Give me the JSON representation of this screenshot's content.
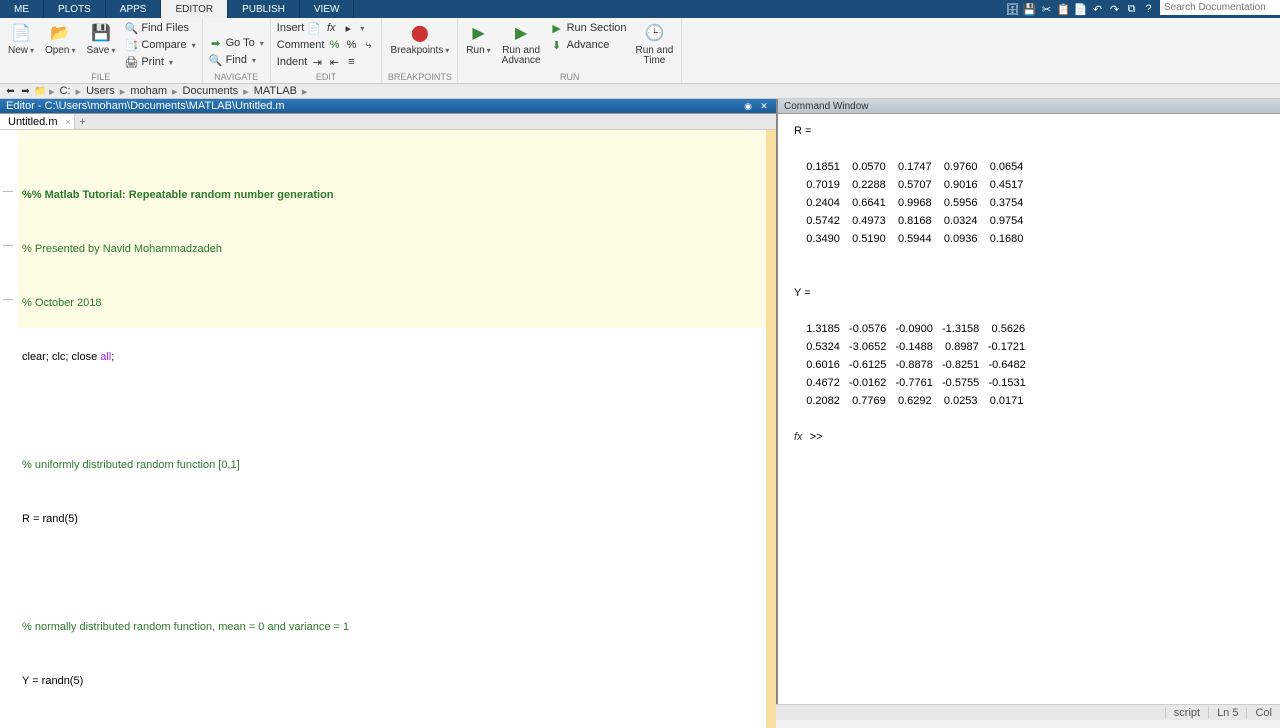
{
  "tabs": {
    "home": "ME",
    "plots": "PLOTS",
    "apps": "APPS",
    "editor": "EDITOR",
    "publish": "PUBLISH",
    "view": "VIEW"
  },
  "search_placeholder": "Search Documentation",
  "ribbon": {
    "file": {
      "new": "New",
      "open": "Open",
      "save": "Save",
      "findfiles": "Find Files",
      "compare": "Compare",
      "print": "Print",
      "label": "FILE"
    },
    "nav": {
      "goto": "Go To",
      "find": "Find",
      "label": "NAVIGATE"
    },
    "edit": {
      "insert": "Insert",
      "comment": "Comment",
      "indent": "Indent",
      "fx": "fx",
      "label": "EDIT"
    },
    "bp": {
      "breakpoints": "Breakpoints",
      "label": "BREAKPOINTS"
    },
    "run": {
      "run": "Run",
      "runadv": "Run and\nAdvance",
      "runsec": "Run Section",
      "advance": "Advance",
      "runtime": "Run and\nTime",
      "label": "RUN"
    }
  },
  "path": [
    "C:",
    "Users",
    "moham",
    "Documents",
    "MATLAB"
  ],
  "editor_title": "Editor - C:\\Users\\moham\\Documents\\MATLAB\\Untitled.m",
  "file_tab": "Untitled.m",
  "cmd_title": "Command Window",
  "code": {
    "l1": "%% Matlab Tutorial: Repeatable random number generation",
    "l2": "% Presented by Navid Mohammadzadeh",
    "l3": "% October 2018",
    "l4a": "clear",
    "l4b": "; clc; close ",
    "l4c": "all",
    "l4d": ";",
    "l6": "% uniformly distributed random function [0,1]",
    "l7": "R = rand(5)",
    "l9": "% normally distributed random function, mean = 0 and variance = 1",
    "l10": "Y = randn(5)"
  },
  "cmd": {
    "R_label": "R =",
    "R_rows": [
      "    0.1851    0.0570    0.1747    0.9760    0.0654",
      "    0.7019    0.2288    0.5707    0.9016    0.4517",
      "    0.2404    0.6641    0.9968    0.5956    0.3754",
      "    0.5742    0.4973    0.8168    0.0324    0.9754",
      "    0.3490    0.5190    0.5944    0.0936    0.1680"
    ],
    "Y_label": "Y =",
    "Y_rows": [
      "    1.3185   -0.0576   -0.0900   -1.3158    0.5626",
      "    0.5324   -3.0652   -0.1488    0.8987   -0.1721",
      "    0.6016   -0.6125   -0.8878   -0.8251   -0.6482",
      "    0.4672   -0.0162   -0.7761   -0.5755   -0.1531",
      "    0.2082    0.7769    0.6292    0.0253    0.0171"
    ],
    "prompt": ">>"
  },
  "status": {
    "type": "script",
    "ln": "Ln 5",
    "col": "Col"
  }
}
